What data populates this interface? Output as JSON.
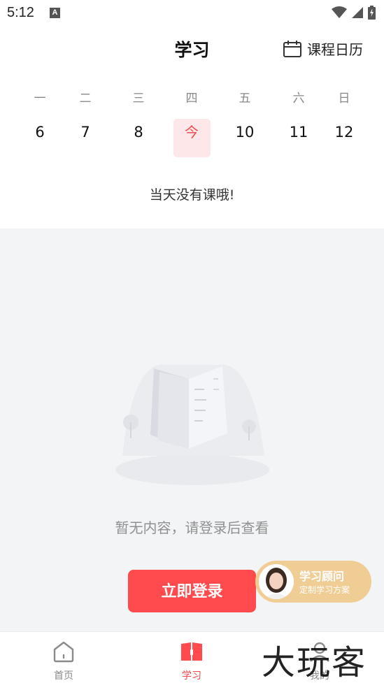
{
  "status_bar": {
    "time": "5:12",
    "notification_badge": "A"
  },
  "header": {
    "title": "学习",
    "calendar_label": "课程日历"
  },
  "week": [
    {
      "weekday": "一",
      "day": "6",
      "today": false
    },
    {
      "weekday": "二",
      "day": "7",
      "today": false
    },
    {
      "weekday": "三",
      "day": "8",
      "today": false
    },
    {
      "weekday": "四",
      "day": "今",
      "today": true
    },
    {
      "weekday": "五",
      "day": "10",
      "today": false
    },
    {
      "weekday": "六",
      "day": "11",
      "today": false
    },
    {
      "weekday": "日",
      "day": "12",
      "today": false
    }
  ],
  "no_class_text": "当天没有课哦!",
  "empty_state": {
    "text": "暂无内容，请登录后查看"
  },
  "login_button": "立即登录",
  "advisor": {
    "title": "学习顾问",
    "subtitle": "定制学习方案"
  },
  "bottom_nav": [
    {
      "label": "首页",
      "icon": "home-icon",
      "active": false
    },
    {
      "label": "学习",
      "icon": "book-icon",
      "active": true
    },
    {
      "label": "我的",
      "icon": "profile-icon",
      "active": false
    }
  ],
  "watermark": "大玩客",
  "colors": {
    "accent": "#ff4a4e",
    "today_bg": "#fde7e8",
    "advisor_bg": "#f0cd94",
    "content_bg": "#f3f4f6"
  }
}
